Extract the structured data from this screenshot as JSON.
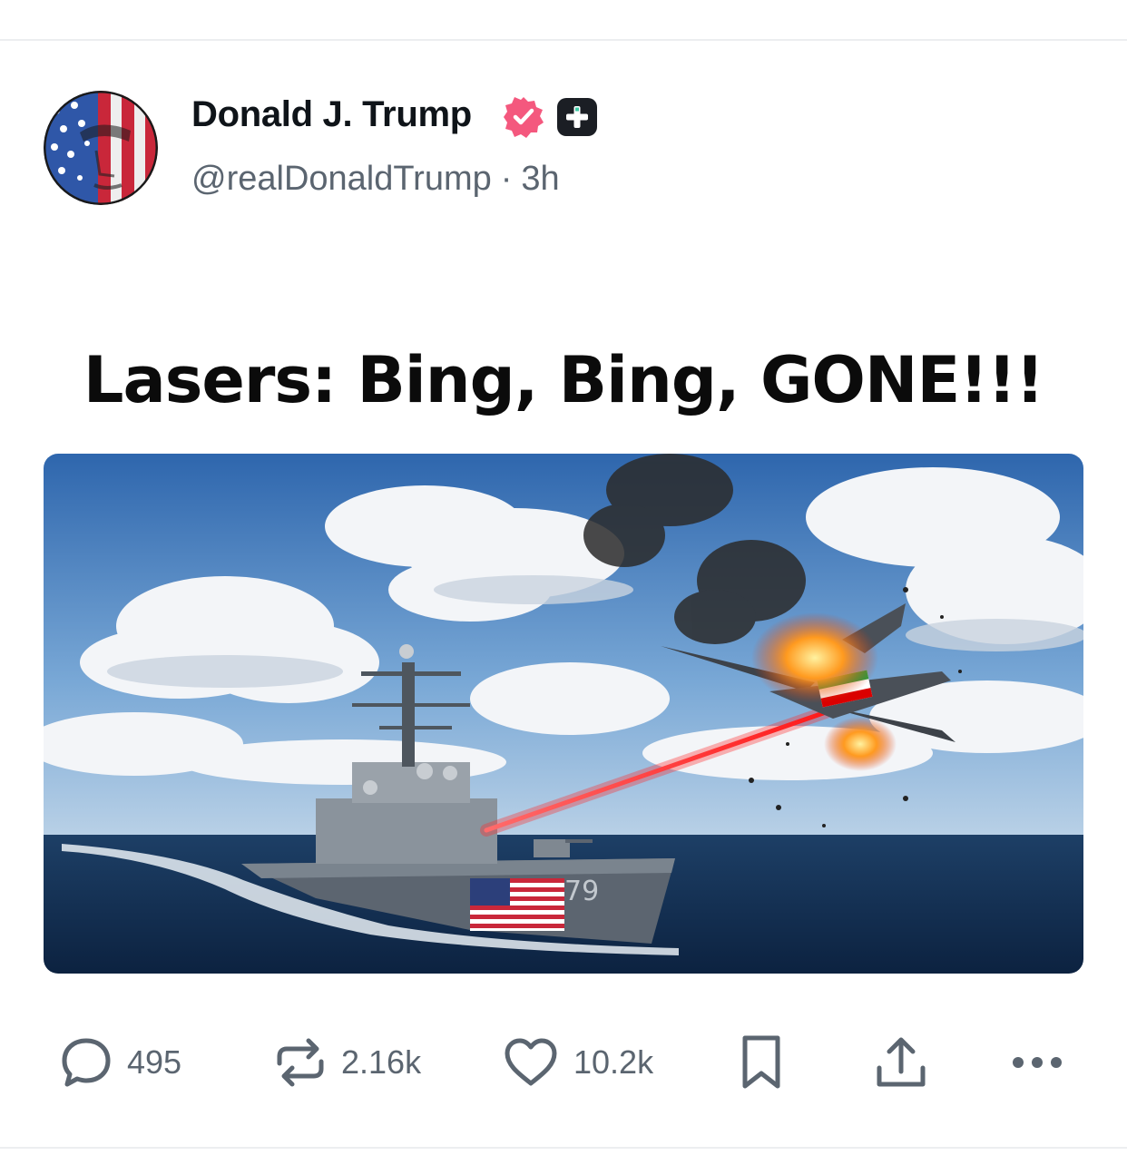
{
  "post": {
    "author": {
      "display_name": "Donald J. Trump",
      "handle": "@realDonaldTrump",
      "separator": "·",
      "time_ago": "3h",
      "verified_badge_color": "#f4587e",
      "plus_badge_color": "#1b1e24"
    },
    "text": "Lasers: Bing, Bing, GONE!!!",
    "media": {
      "hull_number": "79",
      "description_icon": "warship-laser-drone-image"
    },
    "actions": {
      "replies": "495",
      "reposts": "2.16k",
      "likes": "10.2k"
    }
  },
  "colors": {
    "text_primary": "#0f1419",
    "text_secondary": "#5b6570",
    "divider": "#eceef0"
  }
}
